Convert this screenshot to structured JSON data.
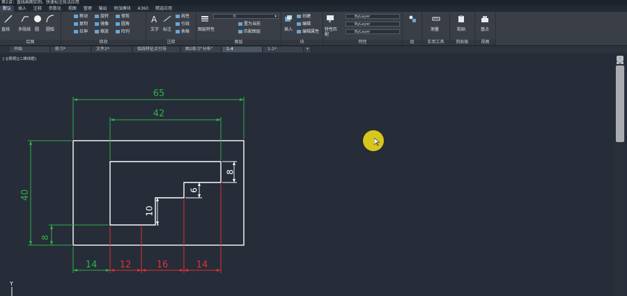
{
  "title": "第2讲：直线画图实例、快速标注技法应用",
  "menu": [
    "默认",
    "插入",
    "注释",
    "参数化",
    "视图",
    "管理",
    "输出",
    "附加模块",
    "A360",
    "精选应用"
  ],
  "menu_active": 0,
  "ribbon": {
    "draw_tools": [
      "直线",
      "多段线",
      "圆",
      "圆弧"
    ],
    "draw_label": "绘图",
    "modify_tools": [
      "移动",
      "旋转",
      "修剪",
      "镜像",
      "圆角",
      "复制",
      "拉伸",
      "缩放",
      "阵列"
    ],
    "modify_label": "修改",
    "annotation_tools": [
      "文字",
      "标注",
      "线性",
      "引线",
      "表格"
    ],
    "annotation_label": "注释",
    "layer_name": "0",
    "layer_tools": [
      "图层特性",
      "置为当前",
      "匹配图层"
    ],
    "layer_label": "图层",
    "block_tools": [
      "插入",
      "创建",
      "编辑",
      "编辑属性"
    ],
    "block_label": "块",
    "properties": [
      "ByLayer",
      "ByLayer",
      "ByLayer"
    ],
    "match_label": "特性匹配",
    "properties_label": "特性",
    "group_label": "组",
    "utilities_tool": "测量",
    "utilities_label": "实用工具",
    "clipboard_tool": "粘贴",
    "clipboard_label": "剪贴板",
    "view_tool": "基点",
    "view_label": "视图"
  },
  "tabs": [
    "开始",
    "练习*",
    "文件2*",
    "弧线特征点引导",
    "图2练习\"分布\"",
    "1-4",
    "1-1*"
  ],
  "active_tab": 5,
  "viewport_label": "[-][俯视][二维线框]",
  "axis_label": "Y",
  "colors": {
    "dim_green": "#2fb24a",
    "dim_red": "#e03232",
    "geometry": "#ffffff",
    "background": "#262c38"
  },
  "drawing": {
    "dimensions": {
      "overall_width": "65",
      "inner_width": "42",
      "overall_height": "40",
      "left_offset_height": "8",
      "step_right": "8",
      "step_middle": "6",
      "step_left": "10",
      "bottom_1": "14",
      "bottom_2": "12",
      "bottom_3": "16",
      "bottom_4": "14"
    }
  }
}
